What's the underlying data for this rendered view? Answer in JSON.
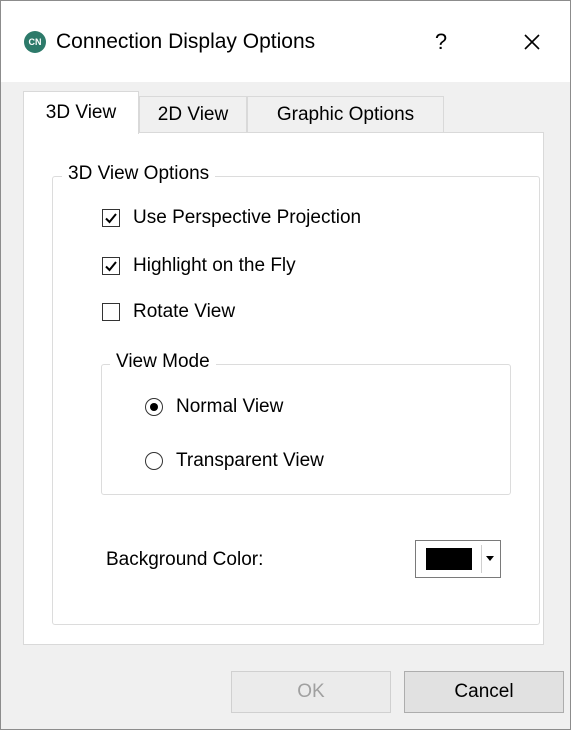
{
  "window": {
    "icon_text": "CN",
    "title": "Connection Display Options",
    "help_label": "?",
    "close_icon": "close-icon"
  },
  "tabs": [
    {
      "label": "3D View",
      "active": true
    },
    {
      "label": "2D View",
      "active": false
    },
    {
      "label": "Graphic Options",
      "active": false
    }
  ],
  "view_options": {
    "legend": "3D View Options",
    "checkboxes": [
      {
        "label": "Use Perspective Projection",
        "checked": true
      },
      {
        "label": "Highlight on the Fly",
        "checked": true
      },
      {
        "label": "Rotate View",
        "checked": false
      }
    ],
    "view_mode": {
      "legend": "View Mode",
      "options": [
        {
          "label": "Normal View",
          "selected": true
        },
        {
          "label": "Transparent View",
          "selected": false
        }
      ]
    },
    "background_color": {
      "label": "Background Color:",
      "value": "#000000"
    }
  },
  "buttons": {
    "ok": "OK",
    "cancel": "Cancel"
  }
}
